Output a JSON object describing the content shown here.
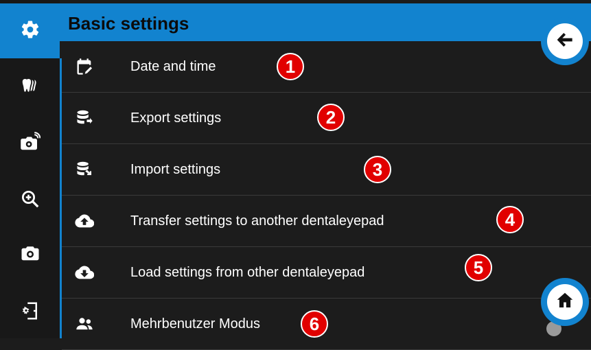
{
  "header": {
    "title": "Basic settings"
  },
  "sidebar": {
    "items": [
      {
        "name": "settings",
        "icon": "gear-icon",
        "active": true
      },
      {
        "name": "teeth",
        "icon": "teeth-icon",
        "active": false
      },
      {
        "name": "remote-camera",
        "icon": "camera-wireless-icon",
        "active": false
      },
      {
        "name": "zoom",
        "icon": "zoom-in-icon",
        "active": false
      },
      {
        "name": "camera",
        "icon": "camera-icon",
        "active": false
      },
      {
        "name": "exit",
        "icon": "settings-exit-icon",
        "active": false
      }
    ]
  },
  "menu": {
    "items": [
      {
        "label": "Date and time",
        "icon": "calendar-edit-icon",
        "badge": "1"
      },
      {
        "label": "Export settings",
        "icon": "database-export-icon",
        "badge": "2"
      },
      {
        "label": "Import settings",
        "icon": "database-import-icon",
        "badge": "3"
      },
      {
        "label": "Transfer settings to another dentaleyepad",
        "icon": "cloud-upload-icon",
        "badge": "4"
      },
      {
        "label": "Load settings from other dentaleyepad",
        "icon": "cloud-download-icon",
        "badge": "5"
      },
      {
        "label": "Mehrbenutzer Modus",
        "icon": "users-icon",
        "badge": "6"
      }
    ]
  },
  "buttons": {
    "back": "back-arrow-icon",
    "home": "home-icon"
  },
  "colors": {
    "accent": "#1283cf",
    "background": "#1c1c1c",
    "badge": "#e10000"
  }
}
